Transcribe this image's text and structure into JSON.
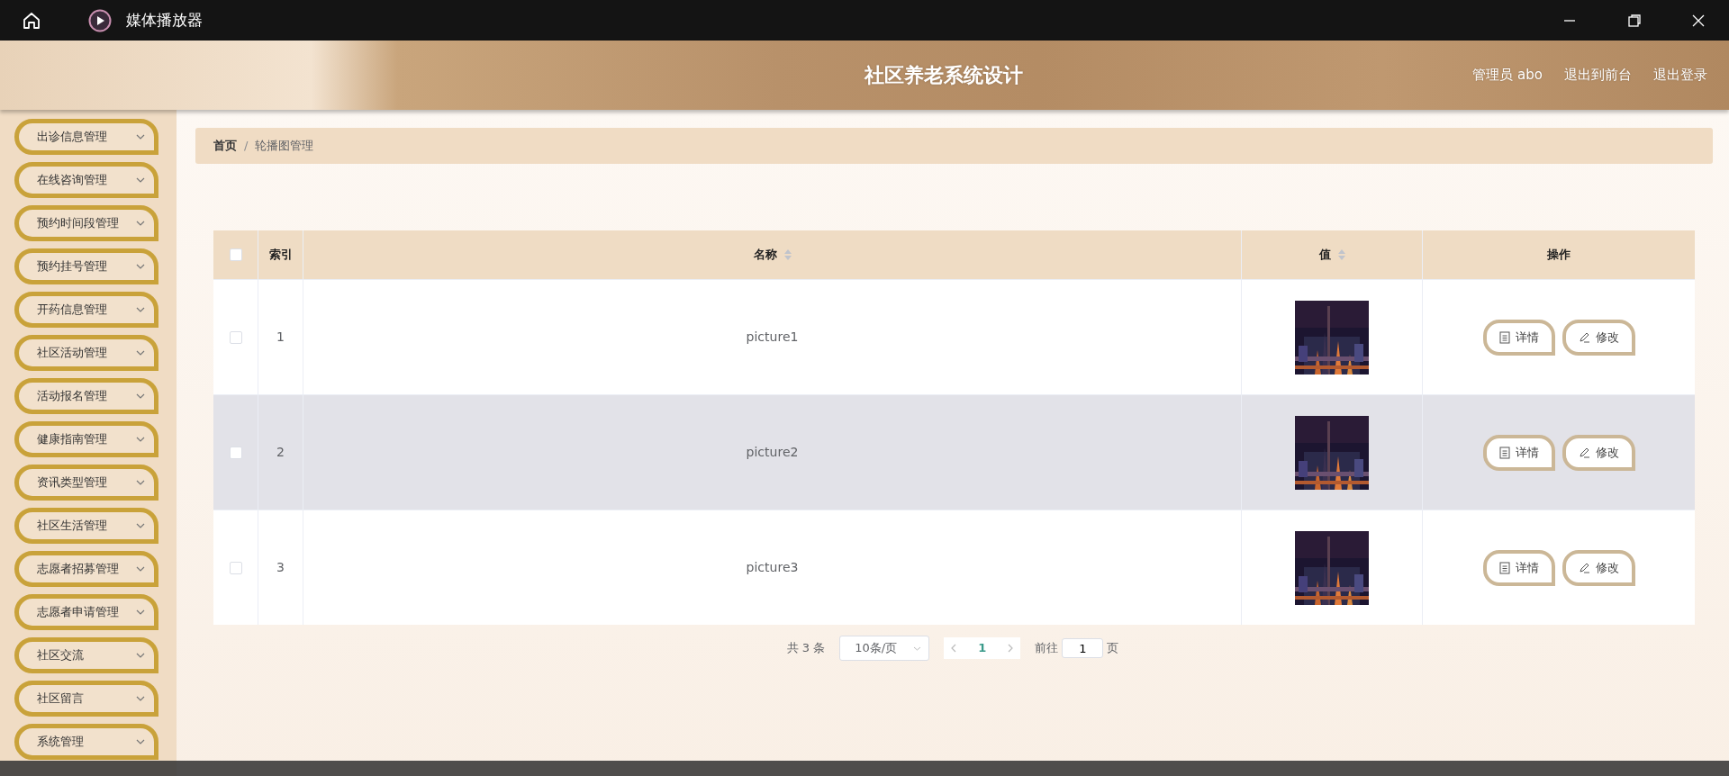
{
  "window": {
    "title": "媒体播放器"
  },
  "header": {
    "title": "社区养老系统设计",
    "user": "管理员 abo",
    "links": [
      "退出到前台",
      "退出登录"
    ]
  },
  "sidebar": {
    "items": [
      {
        "label": "出诊信息管理"
      },
      {
        "label": "在线咨询管理"
      },
      {
        "label": "预约时间段管理"
      },
      {
        "label": "预约挂号管理"
      },
      {
        "label": "开药信息管理"
      },
      {
        "label": "社区活动管理"
      },
      {
        "label": "活动报名管理"
      },
      {
        "label": "健康指南管理"
      },
      {
        "label": "资讯类型管理"
      },
      {
        "label": "社区生活管理"
      },
      {
        "label": "志愿者招募管理"
      },
      {
        "label": "志愿者申请管理"
      },
      {
        "label": "社区交流"
      },
      {
        "label": "社区留言"
      },
      {
        "label": "系统管理"
      }
    ]
  },
  "breadcrumb": {
    "separator": "/",
    "items": [
      "首页",
      "轮播图管理"
    ]
  },
  "table": {
    "select_all": {
      "checked": false
    },
    "columns": [
      {
        "label": "索引",
        "sortable": false
      },
      {
        "label": "名称",
        "sortable": true
      },
      {
        "label": "值",
        "sortable": true
      },
      {
        "label": "操作",
        "sortable": false
      }
    ],
    "rows": [
      {
        "checked": false,
        "highlighted": false,
        "index": "1",
        "name": "picture1",
        "value": {
          "kind": "picture"
        },
        "actions": [
          {
            "kind": "detail",
            "label": "详情"
          },
          {
            "kind": "edit",
            "label": "修改"
          }
        ]
      },
      {
        "checked": false,
        "highlighted": true,
        "index": "2",
        "name": "picture2",
        "value": {
          "kind": "picture"
        },
        "actions": [
          {
            "kind": "detail",
            "label": "详情"
          },
          {
            "kind": "edit",
            "label": "修改"
          }
        ]
      },
      {
        "checked": false,
        "highlighted": false,
        "index": "3",
        "name": "picture3",
        "value": {
          "kind": "picture"
        },
        "actions": [
          {
            "kind": "detail",
            "label": "详情"
          },
          {
            "kind": "edit",
            "label": "修改"
          }
        ]
      }
    ]
  },
  "pagination": {
    "total": "共 3 条",
    "page_size": "10条/页",
    "pages": [
      {
        "label": "1",
        "selected": true
      }
    ],
    "goto_label": "前往",
    "goto_value": "1",
    "goto_suffix": "页"
  }
}
